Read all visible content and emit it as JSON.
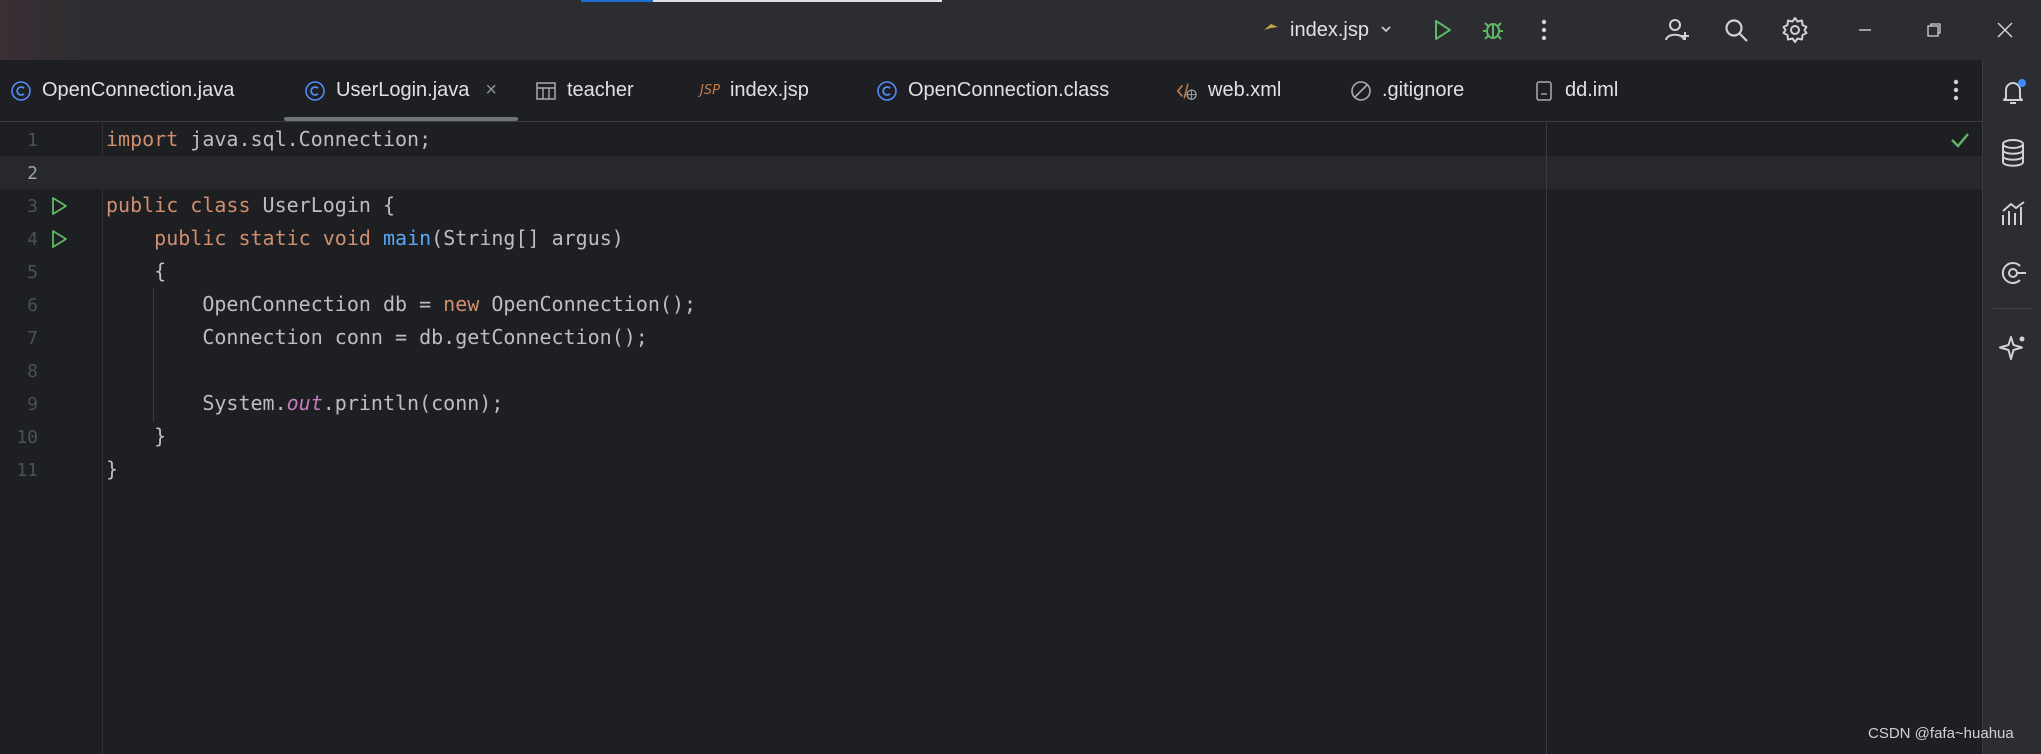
{
  "titlebar": {
    "run_config": "index.jsp"
  },
  "tabs": [
    {
      "label": "OpenConnection.java",
      "icon": "class-icon",
      "active": false
    },
    {
      "label": "UserLogin.java",
      "icon": "class-icon",
      "active": true,
      "close": "×"
    },
    {
      "label": "teacher",
      "icon": "table-icon",
      "active": false
    },
    {
      "label": "index.jsp",
      "icon": "jsp-icon",
      "icon_text": "JSP",
      "active": false
    },
    {
      "label": "OpenConnection.class",
      "icon": "class-icon",
      "active": false
    },
    {
      "label": "web.xml",
      "icon": "xml-icon",
      "active": false
    },
    {
      "label": ".gitignore",
      "icon": "ignore-icon",
      "active": false
    },
    {
      "label": "dd.iml",
      "icon": "iml-icon",
      "active": false
    }
  ],
  "editor": {
    "line_numbers": [
      "1",
      "2",
      "3",
      "4",
      "5",
      "6",
      "7",
      "8",
      "9",
      "10",
      "11"
    ],
    "current_line": "2",
    "lines": [
      {
        "parts": [
          {
            "t": "import",
            "c": "kw"
          },
          {
            "t": " java.sql.Connection;"
          }
        ]
      },
      {
        "parts": []
      },
      {
        "parts": [
          {
            "t": "public",
            "c": "kw"
          },
          {
            "t": " "
          },
          {
            "t": "class",
            "c": "kw"
          },
          {
            "t": " UserLogin {"
          }
        ]
      },
      {
        "parts": [
          {
            "t": "    "
          },
          {
            "t": "public",
            "c": "kw"
          },
          {
            "t": " "
          },
          {
            "t": "static",
            "c": "kw"
          },
          {
            "t": " "
          },
          {
            "t": "void",
            "c": "kw"
          },
          {
            "t": " "
          },
          {
            "t": "main",
            "c": "fn"
          },
          {
            "t": "(String[] argus)"
          }
        ]
      },
      {
        "parts": [
          {
            "t": "    {"
          }
        ]
      },
      {
        "parts": [
          {
            "t": "        OpenConnection db = "
          },
          {
            "t": "new",
            "c": "kw"
          },
          {
            "t": " OpenConnection();"
          }
        ]
      },
      {
        "parts": [
          {
            "t": "        Connection conn = db.getConnection();"
          }
        ]
      },
      {
        "parts": []
      },
      {
        "parts": [
          {
            "t": "        System."
          },
          {
            "t": "out",
            "c": "static-field"
          },
          {
            "t": ".println(conn);"
          }
        ]
      },
      {
        "parts": [
          {
            "t": "    }"
          }
        ]
      },
      {
        "parts": [
          {
            "t": "}"
          }
        ]
      }
    ]
  },
  "watermark": "CSDN @fafa~huahua",
  "colors": {
    "accent": "#1f6fd1",
    "run_green": "#5fb865",
    "keyword": "#cf8e6d",
    "function": "#56a8f5",
    "notification_dot": "#3d8bff"
  }
}
